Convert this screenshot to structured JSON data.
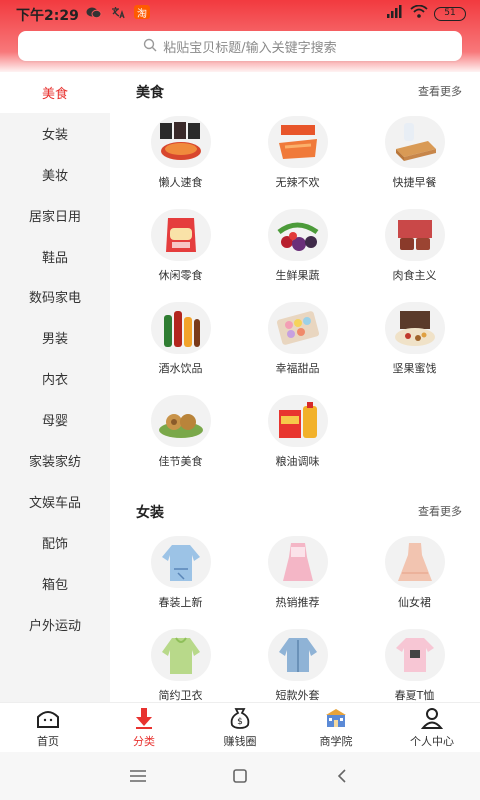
{
  "status": {
    "time": "下午2:29",
    "notifications": [
      "wechat-icon",
      "translate-icon",
      "淘"
    ],
    "battery": "51"
  },
  "search": {
    "placeholder": "粘贴宝贝标题/输入关键字搜索"
  },
  "sidebar": {
    "items": [
      {
        "label": "美食"
      },
      {
        "label": "女装"
      },
      {
        "label": "美妆"
      },
      {
        "label": "居家日用"
      },
      {
        "label": "鞋品"
      },
      {
        "label": "数码家电"
      },
      {
        "label": "男装"
      },
      {
        "label": "内衣"
      },
      {
        "label": "母婴"
      },
      {
        "label": "家装家纺"
      },
      {
        "label": "文娱车品"
      },
      {
        "label": "配饰"
      },
      {
        "label": "箱包"
      },
      {
        "label": "户外运动"
      }
    ]
  },
  "sections": [
    {
      "title": "美食",
      "more": "查看更多",
      "items": [
        {
          "label": "懒人速食"
        },
        {
          "label": "无辣不欢"
        },
        {
          "label": "快捷早餐"
        },
        {
          "label": "休闲零食"
        },
        {
          "label": "生鲜果蔬"
        },
        {
          "label": "肉食主义"
        },
        {
          "label": "酒水饮品"
        },
        {
          "label": "幸福甜品"
        },
        {
          "label": "坚果蜜饯"
        },
        {
          "label": "佳节美食"
        },
        {
          "label": "粮油调味"
        }
      ]
    },
    {
      "title": "女装",
      "more": "查看更多",
      "items": [
        {
          "label": "春装上新"
        },
        {
          "label": "热销推荐"
        },
        {
          "label": "仙女裙"
        },
        {
          "label": "简约卫衣"
        },
        {
          "label": "短款外套"
        },
        {
          "label": "春夏T恤"
        }
      ]
    }
  ],
  "tabs": [
    {
      "label": "首页",
      "icon": "home-icon"
    },
    {
      "label": "分类",
      "icon": "category-arrow-icon"
    },
    {
      "label": "赚钱圈",
      "icon": "money-bag-icon"
    },
    {
      "label": "商学院",
      "icon": "school-icon"
    },
    {
      "label": "个人中心",
      "icon": "profile-icon"
    }
  ],
  "colors": {
    "accent": "#e8322f",
    "header": "#f23a3f"
  }
}
